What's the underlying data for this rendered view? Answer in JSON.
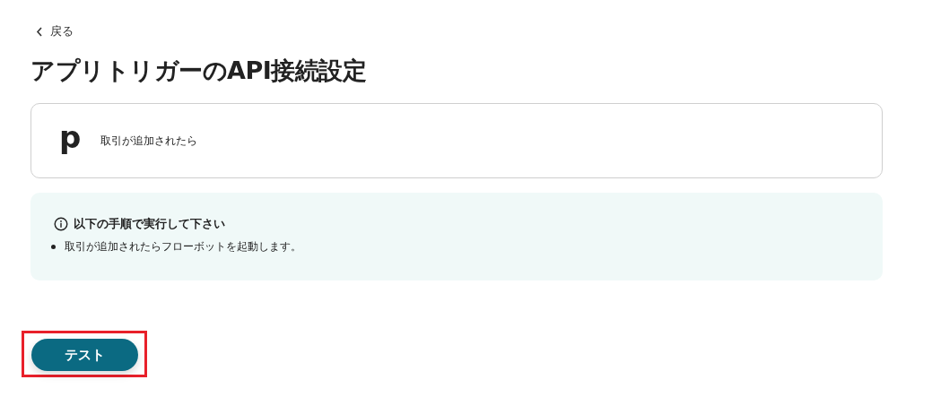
{
  "back_link": {
    "label": "戻る"
  },
  "title": "アプリトリガーのAPI接続設定",
  "trigger_card": {
    "logo": "p",
    "label": "取引が追加されたら"
  },
  "info_box": {
    "heading": "以下の手順で実行して下さい",
    "items": [
      "取引が追加されたらフローボットを起動します。"
    ]
  },
  "test_button": {
    "label": "テスト",
    "highlighted": true
  }
}
